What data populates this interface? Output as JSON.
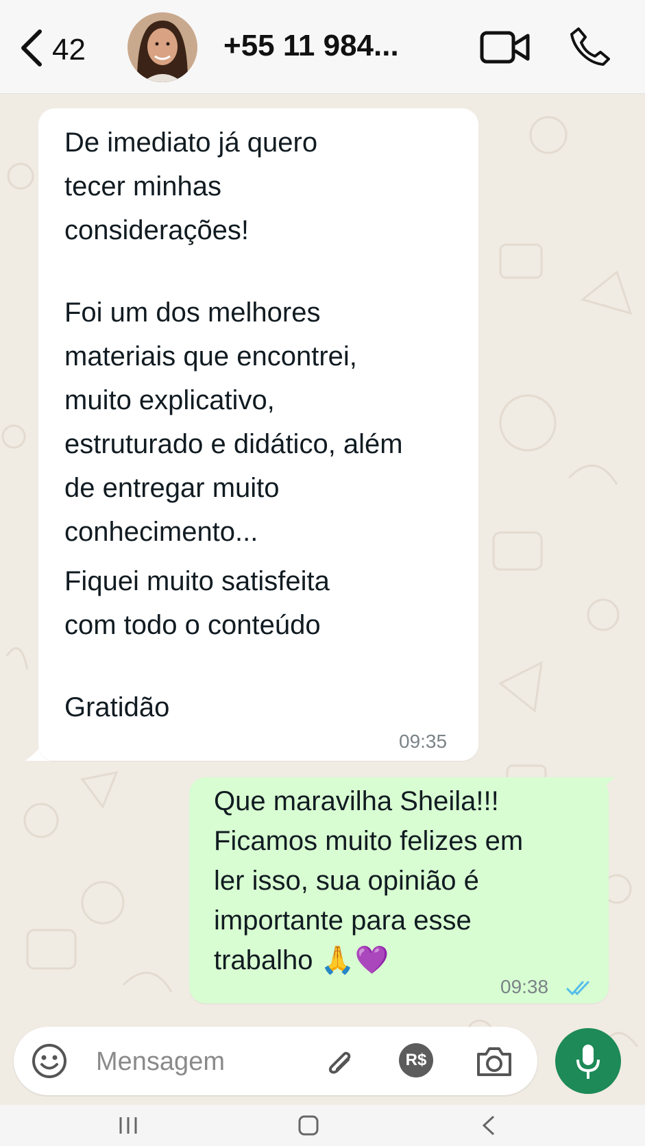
{
  "header": {
    "back_count": "42",
    "contact": "+55 11 984..."
  },
  "messages": [
    {
      "direction": "incoming",
      "paragraphs": [
        "De imediato já quero\ntecer minhas\nconsiderações!",
        "Foi um dos melhores\nmateriais que encontrei,\nmuito explicativo,\nestruturado e didático, além\nde entregar muito\nconhecimento...",
        "Fiquei muito satisfeita\ncom todo o conteúdo",
        "Gratidão"
      ],
      "time": "09:35"
    },
    {
      "direction": "outgoing",
      "text": "Que maravilha Sheila!!!\nFicamos muito felizes em\nler isso, sua opinião é\nimportante para esse\ntrabalho 🙏💜",
      "time": "09:38",
      "status": "read"
    }
  ],
  "composer": {
    "placeholder": "Mensagem",
    "payment_label": "R$"
  },
  "colors": {
    "incoming_bubble": "#ffffff",
    "outgoing_bubble": "#d8fdd2",
    "accent": "#1d8a57",
    "read_ticks": "#53bdeb",
    "chat_background": "#f0ebe3"
  },
  "icons": [
    "chevron-left-icon",
    "video-icon",
    "phone-icon",
    "emoji-icon",
    "paperclip-icon",
    "payment-icon",
    "camera-icon",
    "mic-icon",
    "double-check-icon",
    "recent-apps-icon",
    "home-icon",
    "back-icon"
  ]
}
